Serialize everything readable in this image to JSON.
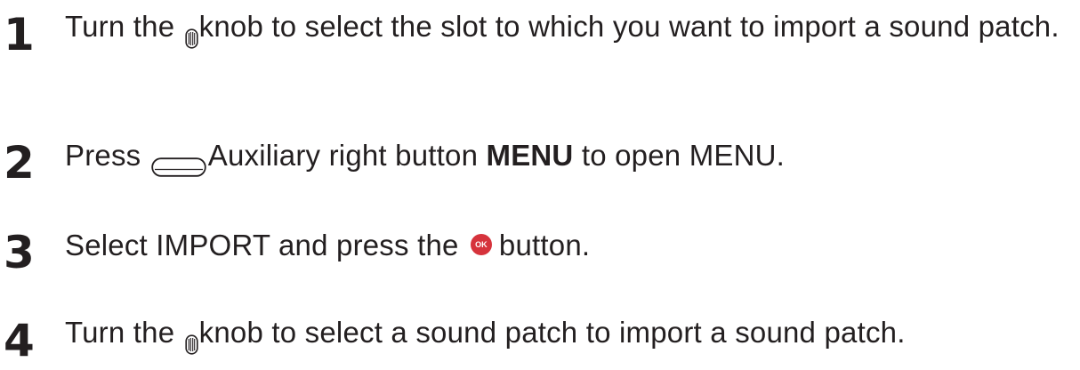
{
  "steps": [
    {
      "number": "1",
      "before": "Turn the ",
      "after": "knob to select the slot to which you want to import a sound patch."
    },
    {
      "number": "2",
      "before": "Press ",
      "after": "Auxiliary right button ",
      "bold": "MENU",
      "tail": " to open MENU."
    },
    {
      "number": "3",
      "before": "Select IMPORT and press the ",
      "after": "button."
    },
    {
      "number": "4",
      "before": "Turn the ",
      "after": "knob to select a sound patch to import a sound patch."
    }
  ],
  "icons": {
    "knob": "knob-icon",
    "aux_button": "auxiliary-right-button-icon",
    "ok": "ok-button-icon",
    "ok_label": "OK",
    "ok_color": "#d6333c"
  }
}
